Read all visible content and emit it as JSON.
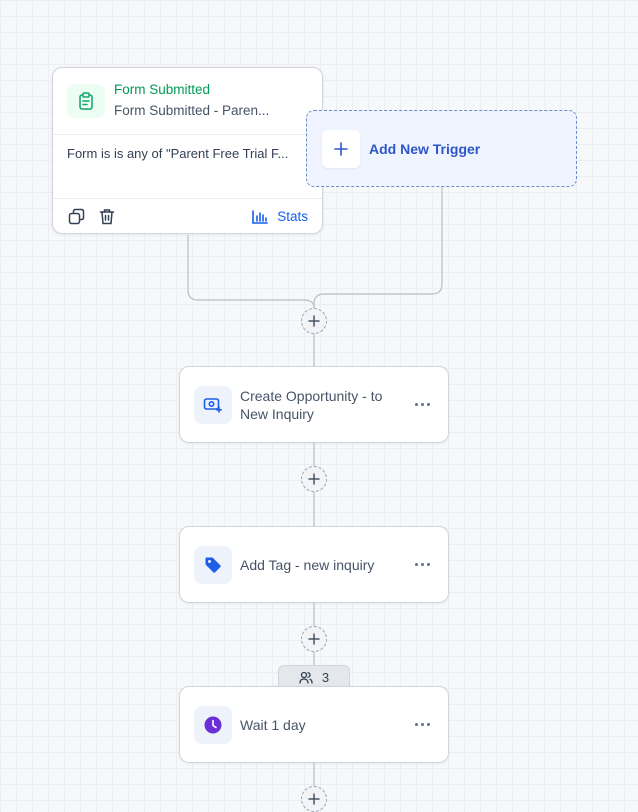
{
  "trigger": {
    "title": "Form Submitted",
    "subtitle": "Form Submitted - Paren...",
    "condition": "Form is is any of \"Parent Free Trial F...",
    "stats_label": "Stats",
    "icon": "clipboard-icon"
  },
  "add_trigger": {
    "label": "Add New Trigger"
  },
  "actions": [
    {
      "label": "Create Opportunity - to New Inquiry",
      "icon": "opportunity-icon"
    },
    {
      "label": "Add Tag - new inquiry",
      "icon": "tag-icon"
    },
    {
      "label": "Wait 1 day",
      "icon": "clock-icon"
    }
  ],
  "contacts_count": "3",
  "colors": {
    "trigger_green": "#039855",
    "accent_blue": "#155eef",
    "tag_blue": "#1d5de8",
    "wait_purple": "#6b2fd6"
  }
}
